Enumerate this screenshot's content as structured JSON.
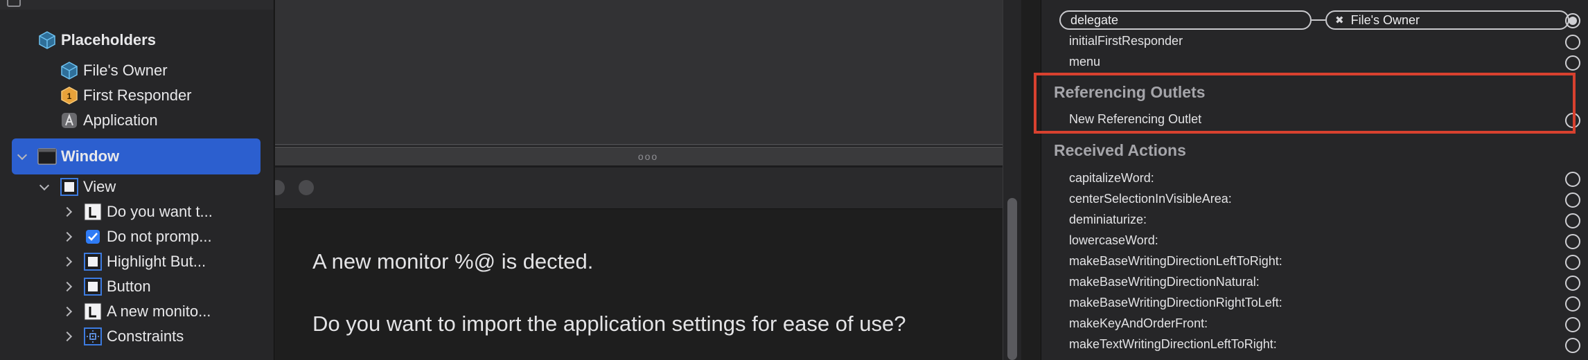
{
  "outline": {
    "placeholders_label": "Placeholders",
    "files_owner_label": "File's Owner",
    "first_responder_label": "First Responder",
    "application_label": "Application",
    "window_label": "Window",
    "view_label": "View",
    "children": [
      {
        "label": "Do you want t...",
        "icon": "label-icon"
      },
      {
        "label": "Do not promp...",
        "icon": "checkbox-icon"
      },
      {
        "label": "Highlight But...",
        "icon": "view-icon"
      },
      {
        "label": "Button",
        "icon": "view-icon"
      },
      {
        "label": "A new monito...",
        "icon": "label-icon"
      },
      {
        "label": "Constraints",
        "icon": "constraints-icon"
      }
    ]
  },
  "canvas": {
    "divider_label": "ooo",
    "message_line1": "A new monitor %@ is dected.",
    "message_line2": "Do you want to import the application settings for ease of use?"
  },
  "inspector": {
    "outlets": [
      {
        "name": "delegate",
        "connected_to": "File's Owner",
        "connected": true
      },
      {
        "name": "initialFirstResponder",
        "connected": false
      },
      {
        "name": "menu",
        "connected": false
      }
    ],
    "referencing_outlets_title": "Referencing Outlets",
    "new_referencing_outlet_label": "New Referencing Outlet",
    "received_actions_title": "Received Actions",
    "actions": [
      "capitalizeWord:",
      "centerSelectionInVisibleArea:",
      "deminiaturize:",
      "lowercaseWord:",
      "makeBaseWritingDirectionLeftToRight:",
      "makeBaseWritingDirectionNatural:",
      "makeBaseWritingDirectionRightToLeft:",
      "makeKeyAndOrderFront:",
      "makeTextWritingDirectionLeftToRight:"
    ]
  },
  "colors": {
    "selection": "#2c5fcf",
    "highlight_border": "#d8412f",
    "placeholder_cube": "#4aa3d8",
    "first_responder": "#e8a23a"
  }
}
